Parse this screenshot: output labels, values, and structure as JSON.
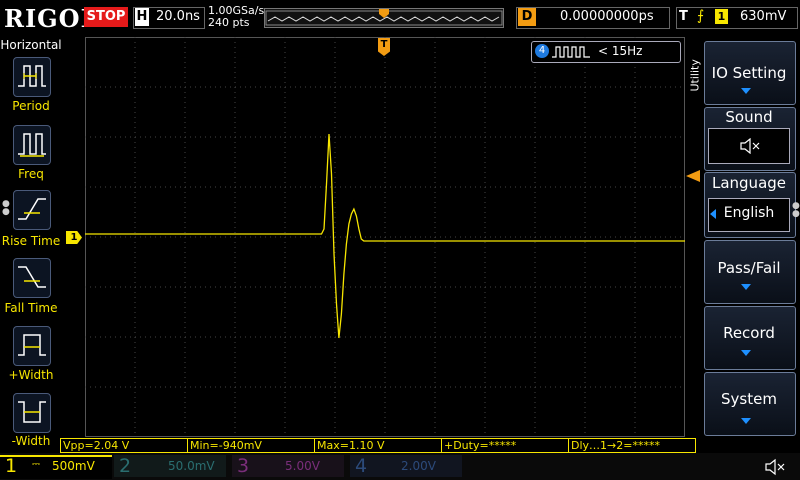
{
  "header": {
    "logo": "RIGOL",
    "run_state": "STOP",
    "timebase_letter": "H",
    "timebase": "20.0ns",
    "sample_rate": "1.00GSa/s",
    "points": "240 pts",
    "delay_letter": "D",
    "delay": "0.00000000ps",
    "trigger_letter": "T",
    "trigger_channel": "1",
    "trigger_level": "630mV"
  },
  "left_panel": {
    "title": "Horizontal",
    "items": [
      {
        "label": "Period"
      },
      {
        "label": "Freq"
      },
      {
        "label": "Rise Time"
      },
      {
        "label": "Fall Time"
      },
      {
        "label": "+Width"
      },
      {
        "label": "-Width"
      }
    ]
  },
  "screen": {
    "channel_marker": "1",
    "trigger_pos_marker": "T",
    "freq_channel": "4",
    "freq_text": "< 15Hz"
  },
  "right_panel": {
    "utility": "Utility",
    "items": [
      {
        "label": "IO Setting"
      },
      {
        "label": "Sound"
      },
      {
        "label": "Language",
        "value": "English"
      },
      {
        "label": "Pass/Fail"
      },
      {
        "label": "Record"
      },
      {
        "label": "System"
      }
    ]
  },
  "measurements": [
    "Vpp=2.04 V",
    "Min=-940mV",
    "Max=1.10 V",
    "+Duty=*****",
    "Dly…1→2=*****"
  ],
  "channels": [
    {
      "num": "1",
      "scale": "500mV",
      "color": "#f7e600",
      "active": true
    },
    {
      "num": "2",
      "scale": "50.0mV",
      "color": "#2bd3e0",
      "active": false
    },
    {
      "num": "3",
      "scale": "5.00V",
      "color": "#d23ad6",
      "active": false
    },
    {
      "num": "4",
      "scale": "2.00V",
      "color": "#1e7ae0",
      "active": false
    }
  ],
  "colors": {
    "ch1": "#f7e600",
    "stop": "#e51a1a",
    "trigger": "#f39c12",
    "accent": "#1e90ff"
  },
  "waveform": {
    "volts_per_div": 0.5,
    "time_per_div_ns": 20,
    "baseline_v": 0.1,
    "samples_v": [
      0.1,
      0.1,
      0.1,
      0.1,
      0.1,
      0.1,
      0.1,
      0.1,
      0.1,
      0.1,
      0.1,
      0.1,
      0.1,
      0.1,
      0.1,
      0.1,
      0.1,
      0.1,
      0.1,
      0.1,
      0.1,
      0.1,
      0.1,
      0.1,
      0.1,
      0.1,
      0.1,
      0.1,
      0.1,
      0.1,
      0.1,
      0.1,
      0.1,
      0.1,
      0.1,
      0.1,
      0.1,
      0.1,
      0.1,
      0.1,
      0.1,
      0.1,
      0.1,
      0.1,
      0.1,
      0.1,
      0.1,
      0.1,
      0.1,
      0.1,
      0.1,
      0.1,
      0.1,
      0.1,
      0.1,
      0.1,
      0.1,
      0.1,
      0.1,
      0.1,
      0.1,
      0.1,
      0.1,
      0.1,
      0.1,
      0.1,
      0.1,
      0.1,
      0.1,
      0.1,
      0.1,
      0.1,
      0.1,
      0.1,
      0.1,
      0.1,
      0.1,
      0.1,
      0.1,
      0.1,
      0.1,
      0.1,
      0.1,
      0.1,
      0.1,
      0.1,
      0.1,
      0.1,
      0.1,
      0.1,
      0.1,
      0.1,
      0.1,
      0.1,
      0.1,
      0.1,
      0.15,
      0.6,
      1.1,
      0.7,
      -0.1,
      -0.6,
      -0.94,
      -0.7,
      -0.3,
      0.0,
      0.2,
      0.3,
      0.35,
      0.28,
      0.15,
      0.05,
      0.03,
      0.03,
      0.03,
      0.03,
      0.03,
      0.03,
      0.03,
      0.03,
      0.03,
      0.03,
      0.03,
      0.03,
      0.03,
      0.03,
      0.03,
      0.03,
      0.03,
      0.03,
      0.03,
      0.03,
      0.03,
      0.03,
      0.03,
      0.03,
      0.03,
      0.03,
      0.03,
      0.03,
      0.03,
      0.03,
      0.03,
      0.03,
      0.03,
      0.03,
      0.03,
      0.03,
      0.03,
      0.03,
      0.03,
      0.03,
      0.03,
      0.03,
      0.03,
      0.03,
      0.03,
      0.03,
      0.03,
      0.03,
      0.03,
      0.03,
      0.03,
      0.03,
      0.03,
      0.03,
      0.03,
      0.03,
      0.03,
      0.03,
      0.03,
      0.03,
      0.03,
      0.03,
      0.03,
      0.03,
      0.03,
      0.03,
      0.03,
      0.03,
      0.03,
      0.03,
      0.03,
      0.03,
      0.03,
      0.03,
      0.03,
      0.03,
      0.03,
      0.03,
      0.03,
      0.03,
      0.03,
      0.03,
      0.03,
      0.03,
      0.03,
      0.03,
      0.03,
      0.03,
      0.03,
      0.03,
      0.03,
      0.03,
      0.03,
      0.03,
      0.03,
      0.03,
      0.03,
      0.03,
      0.03,
      0.03,
      0.03,
      0.03,
      0.03,
      0.03,
      0.03,
      0.03,
      0.03,
      0.03,
      0.03,
      0.03,
      0.03,
      0.03,
      0.03,
      0.03,
      0.03,
      0.03,
      0.03,
      0.03,
      0.03,
      0.03,
      0.03,
      0.03,
      0.03,
      0.03,
      0.03,
      0.03,
      0.03,
      0.03,
      0.03,
      0.03
    ]
  }
}
